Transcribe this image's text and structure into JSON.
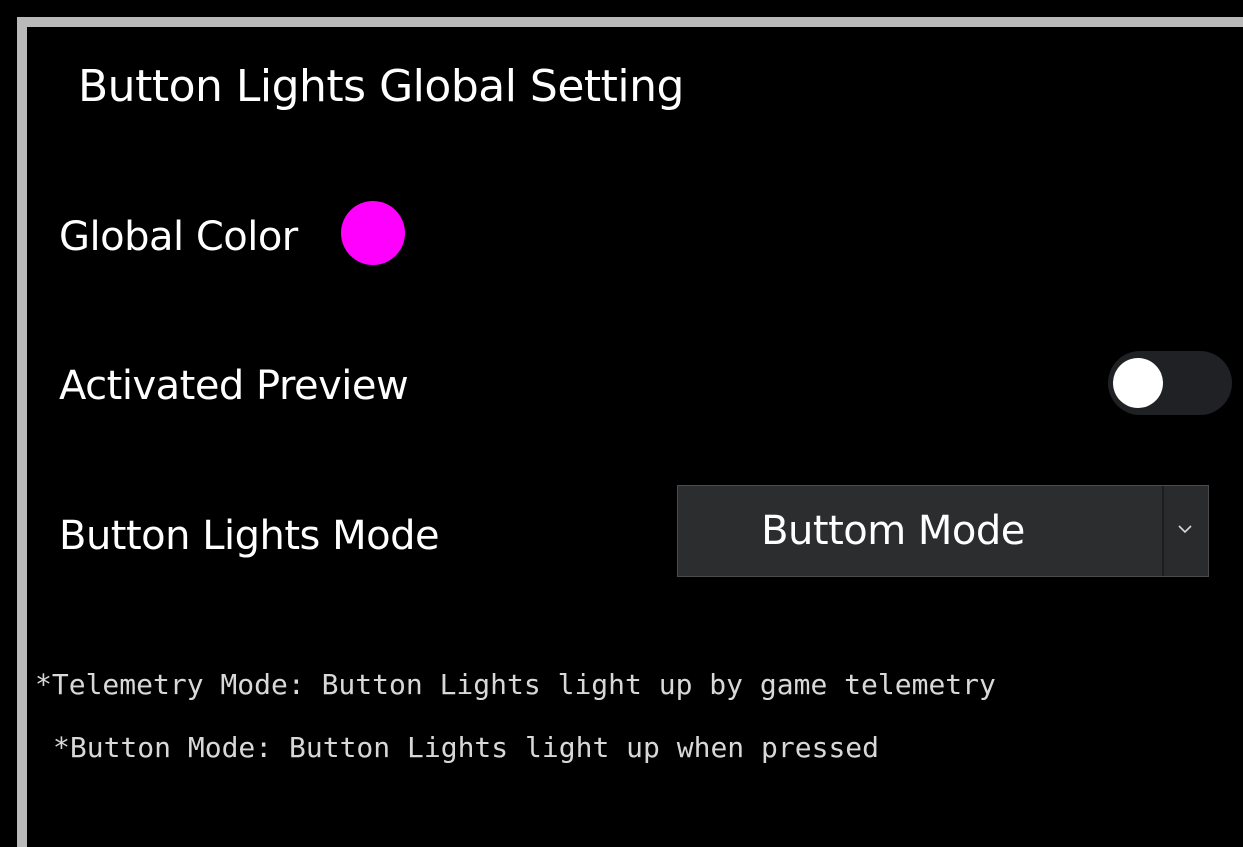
{
  "header": {
    "title": "Button Lights Global Setting"
  },
  "settings": {
    "global_color": {
      "label": "Global Color",
      "value": "#ff00ff"
    },
    "activated_preview": {
      "label": "Activated Preview",
      "enabled": false
    },
    "button_lights_mode": {
      "label": "Button Lights Mode",
      "selected": "Buttom Mode",
      "dropdown_icon": "chevron-down-icon"
    }
  },
  "notes": [
    "*Telemetry Mode: Button Lights light up by game telemetry",
    "*Button Mode: Button Lights light up when pressed"
  ],
  "colors": {
    "background": "#000000",
    "frame_border": "#b9b9b9",
    "toggle_track": "#1f2124",
    "toggle_knob": "#ffffff",
    "select_bg": "#2c2d2f"
  }
}
